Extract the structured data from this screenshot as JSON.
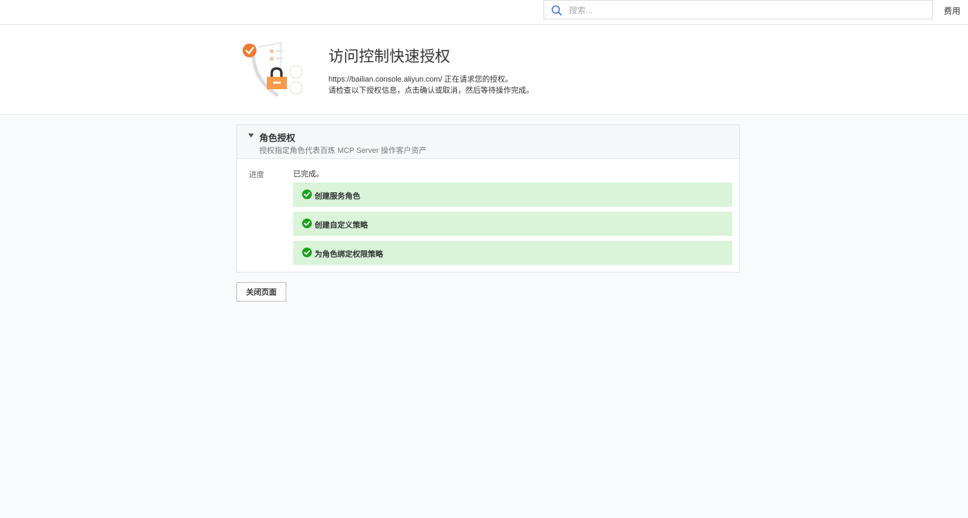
{
  "topbar": {
    "search_placeholder": "搜索...",
    "link_label": "费用"
  },
  "hero": {
    "title": "访问控制快速授权",
    "url": "https://bailian.console.aliyun.com/",
    "desc_line1_suffix": " 正在请求您的授权。",
    "desc_line2": "请检查以下授权信息，点击确认或取消，然后等待操作完成。",
    "illustration_icon": "shield-lock-icon"
  },
  "card": {
    "title": "角色授权",
    "subtitle": "授权指定角色代表百炼 MCP Server 操作客户资产",
    "progress_label": "进度",
    "progress_status": "已完成。",
    "steps": [
      {
        "label": "创建服务角色",
        "icon": "check-circle-icon",
        "status": "done"
      },
      {
        "label": "创建自定义策略",
        "icon": "check-circle-icon",
        "status": "done"
      },
      {
        "label": "为角色绑定权限策略",
        "icon": "check-circle-icon",
        "status": "done"
      }
    ]
  },
  "actions": {
    "close_label": "关闭页面"
  },
  "colors": {
    "accent_orange": "#f07a2d",
    "success_green": "#1aa31a",
    "step_bg": "#d9f4d9"
  }
}
